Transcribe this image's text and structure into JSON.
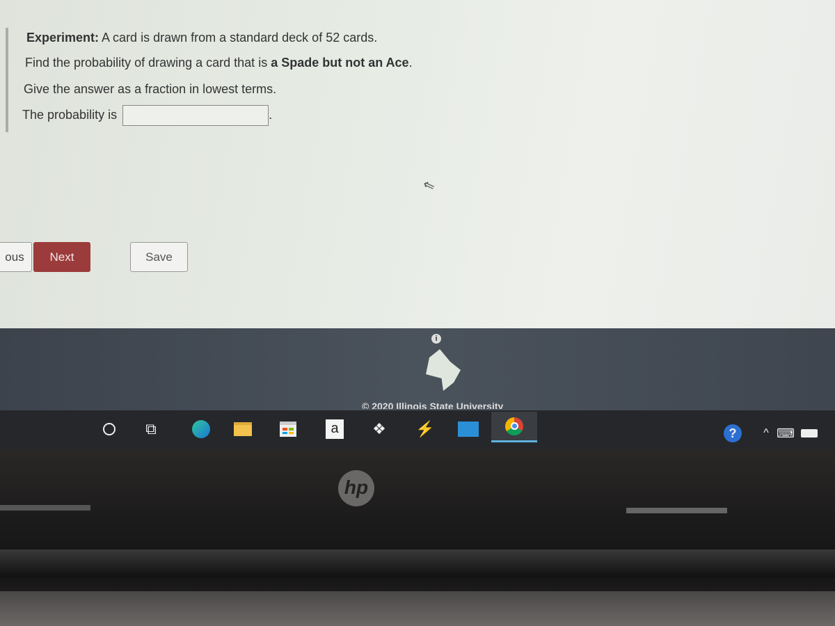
{
  "question": {
    "experiment_label": "Experiment:",
    "experiment_text": " A card is drawn from a standard deck of 52 cards.",
    "find_prefix": "Find the probability of drawing a card that is ",
    "find_bold": "a Spade but not an Ace",
    "find_suffix": ".",
    "instruction": "Give the answer as a fraction in lowest terms.",
    "answer_label": "The probability is",
    "answer_value": "",
    "answer_suffix": "."
  },
  "buttons": {
    "previous": "ous",
    "next": "Next",
    "save": "Save"
  },
  "footer": {
    "info_icon": "i",
    "copyright": "© 2020 Illinois State University"
  },
  "taskbar": {
    "icons": [
      "search",
      "task-view",
      "edge",
      "file-explorer",
      "store",
      "amazon",
      "dropbox",
      "bolt",
      "mail",
      "chrome"
    ],
    "amazon_letter": "a",
    "tray": [
      "help",
      "chevron-up",
      "touch-keyboard",
      "battery"
    ]
  },
  "laptop": {
    "logo": "hp"
  },
  "colors": {
    "next_button": "#9c3b3b",
    "chrome_active": "#5fb0e0"
  }
}
